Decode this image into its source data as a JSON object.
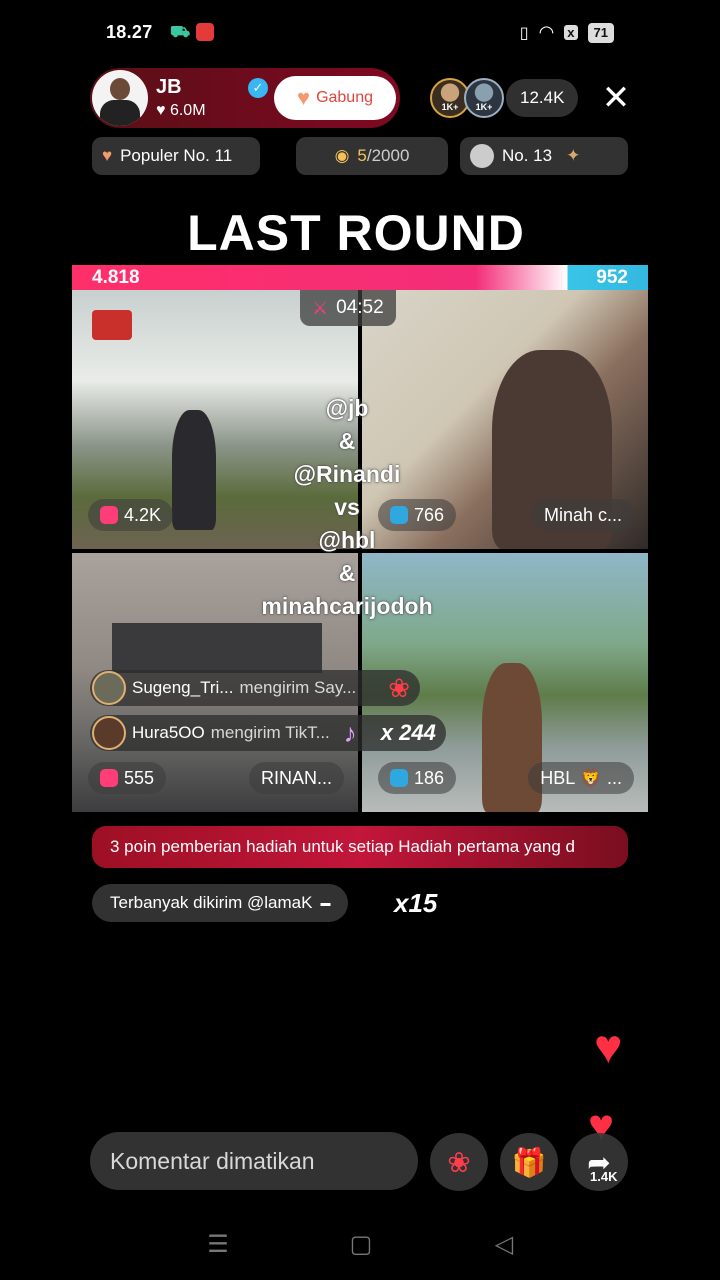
{
  "status_bar": {
    "time": "18.27",
    "battery": "71"
  },
  "host": {
    "name": "JB",
    "likes": "6.0M",
    "join_label": "Gabung"
  },
  "viewers": {
    "badge_a": "1K+",
    "badge_b": "1K+",
    "count": "12.4K"
  },
  "chips": {
    "popular": "Populer No. 11",
    "progress_current": "5",
    "progress_total": "/2000",
    "rank": "No. 13"
  },
  "battle": {
    "title": "LAST ROUND",
    "score_left": "4.818",
    "score_right": "952",
    "timer": "04:52",
    "overlay_lines": [
      "@jb",
      "&",
      "@Rinandi",
      "vs",
      "@hbl",
      "&",
      "minahcarijodoh"
    ],
    "tiles": [
      {
        "score": "4.2K",
        "name": ""
      },
      {
        "score": "766",
        "name": "Minah c..."
      },
      {
        "score": "555",
        "name": "RINAN..."
      },
      {
        "score": "186",
        "name": "HBL 🦁 ..."
      }
    ]
  },
  "gifts": [
    {
      "user": "Sugeng_Tri...",
      "text": "mengirim Say...",
      "count": ""
    },
    {
      "user": "Hura5OO",
      "text": "mengirim TikT...",
      "count": "x 244"
    }
  ],
  "banner": {
    "text": "3 poin pemberian hadiah untuk setiap Hadiah pertama yang d"
  },
  "top_sender": {
    "text": "Terbanyak dikirim @lamaK",
    "multiplier": "x15"
  },
  "bottom": {
    "comment_placeholder": "Komentar dimatikan",
    "share_count": "1.4K"
  },
  "colors": {
    "accent_pink": "#ff2f6a",
    "accent_blue": "#38c5e8",
    "banner_red": "#c2163a",
    "heart_red": "#ff3043"
  }
}
